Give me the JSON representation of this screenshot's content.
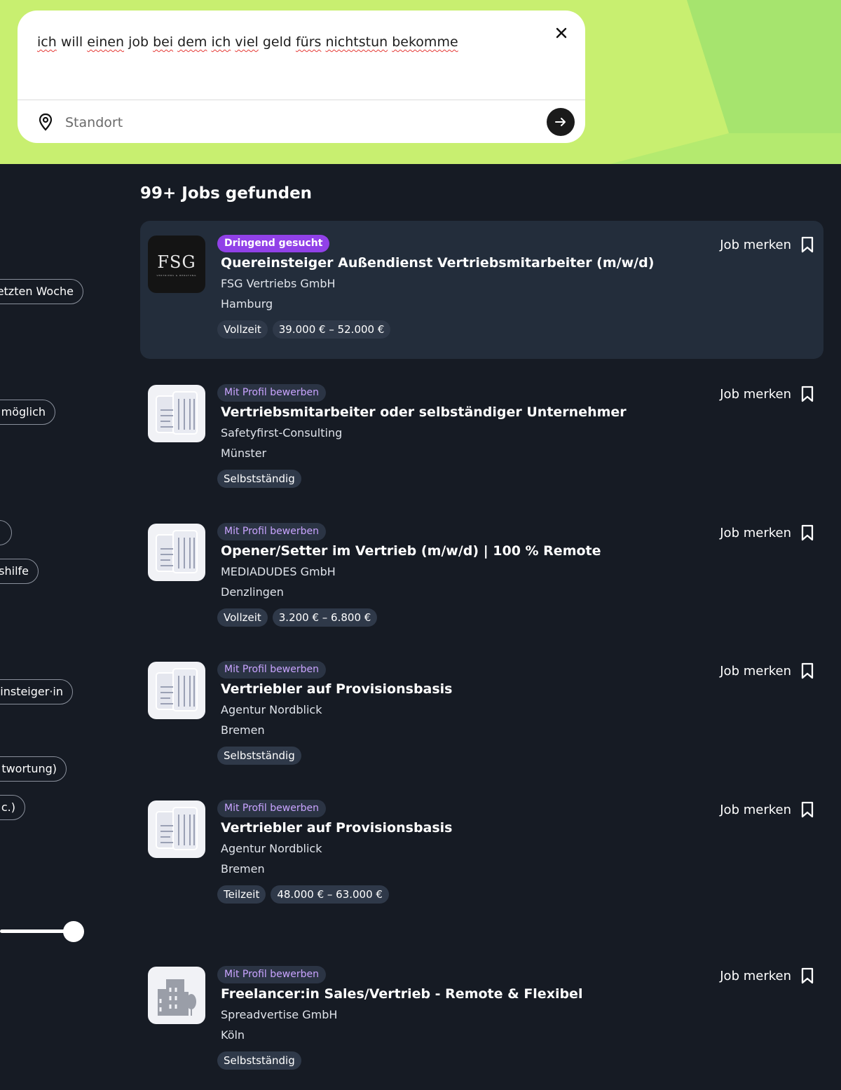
{
  "search": {
    "query_words": [
      "ich",
      "will",
      "einen",
      "job",
      "bei",
      "dem",
      "ich",
      "viel",
      "geld",
      "fürs",
      "nichtstun",
      "bekomme"
    ],
    "location_placeholder": "Standort"
  },
  "sidebar": {
    "chips": [
      "etzten Woche",
      "möglich",
      "",
      "shilfe",
      "insteiger·in",
      "twortung)",
      "c.)"
    ]
  },
  "results": {
    "title": "99+ Jobs gefunden",
    "save_label": "Job merken",
    "jobs": [
      {
        "badge": "Dringend gesucht",
        "title": "Quereinsteiger Außendienst Vertriebsmitarbeiter (m/w/d)",
        "company": "FSG Vertriebs GmbH",
        "city": "Hamburg",
        "tags": [
          "Vollzeit",
          "39.000 € – 52.000 €"
        ],
        "logo_text": "FSG",
        "logo_subtext": "VERTRIEBS & BERATUNG"
      },
      {
        "badge": "Mit Profil bewerben",
        "title": "Vertriebsmitarbeiter oder selbständiger Unternehmer",
        "company": "Safetyfirst-Consulting",
        "city": "Münster",
        "tags": [
          "Selbstständig"
        ]
      },
      {
        "badge": "Mit Profil bewerben",
        "title": "Opener/Setter im Vertrieb (m/w/d) | 100 % Remote",
        "company": "MEDIADUDES GmbH",
        "city": "Denzlingen",
        "tags": [
          "Vollzeit",
          "3.200 € – 6.800 €"
        ]
      },
      {
        "badge": "Mit Profil bewerben",
        "title": "Vertriebler auf Provisionsbasis",
        "company": "Agentur Nordblick",
        "city": "Bremen",
        "tags": [
          "Selbstständig"
        ]
      },
      {
        "badge": "Mit Profil bewerben",
        "title": "Vertriebler auf Provisionsbasis",
        "company": "Agentur Nordblick",
        "city": "Bremen",
        "tags": [
          "Teilzeit",
          "48.000 € – 63.000 €"
        ]
      },
      {
        "badge": "Mit Profil bewerben",
        "title": "Freelancer:in Sales/Vertrieb - Remote & Flexibel",
        "company": "Spreadvertise GmbH",
        "city": "Köln",
        "tags": [
          "Selbstständig"
        ]
      }
    ]
  },
  "colors": {
    "hero_lime": "#c8ef70",
    "hero_green": "#a6e46e",
    "page_bg": "#161b24",
    "card_highlight": "#232d3b",
    "badge_urgent": "#9141e8",
    "badge_profile_text": "#c9a4ff"
  }
}
